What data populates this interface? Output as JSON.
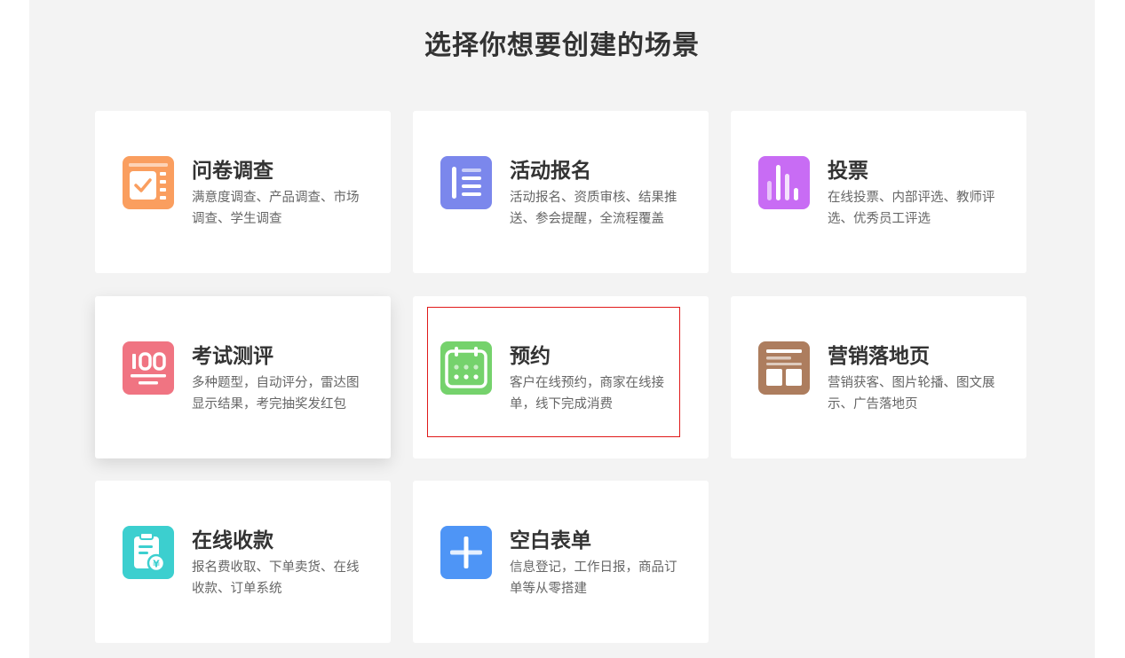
{
  "header": {
    "title": "选择你想要创建的场景"
  },
  "colors": {
    "survey": "#fa9e5f",
    "signup": "#7b87ec",
    "vote": "#c86cf4",
    "exam": "#f07482",
    "booking": "#75d26c",
    "landing": "#ad7d5e",
    "payment": "#3ccfcf",
    "blank": "#4e95f6",
    "selection": "#e01a1a"
  },
  "scenes": [
    {
      "title": "问卷调查",
      "desc": "满意度调查、产品调查、市场调查、学生调查",
      "icon": "survey-checklist-icon"
    },
    {
      "title": "活动报名",
      "desc": "活动报名、资质审核、结果推送、参会提醒，全流程覆盖",
      "icon": "signup-list-icon"
    },
    {
      "title": "投票",
      "desc": "在线投票、内部评选、教师评选、优秀员工评选",
      "icon": "vote-bars-icon"
    },
    {
      "title": "考试测评",
      "desc": "多种题型，自动评分，雷达图显示结果，考完抽奖发红包",
      "icon": "exam-score-icon"
    },
    {
      "title": "预约",
      "desc": "客户在线预约，商家在线接单，线下完成消费",
      "icon": "calendar-icon"
    },
    {
      "title": "营销落地页",
      "desc": "营销获客、图片轮播、图文展示、广告落地页",
      "icon": "landing-page-icon"
    },
    {
      "title": "在线收款",
      "desc": "报名费收取、下单卖货、在线收款、订单系统",
      "icon": "payment-clipboard-icon"
    },
    {
      "title": "空白表单",
      "desc": "信息登记，工作日报，商品订单等从零搭建",
      "icon": "plus-icon"
    }
  ]
}
